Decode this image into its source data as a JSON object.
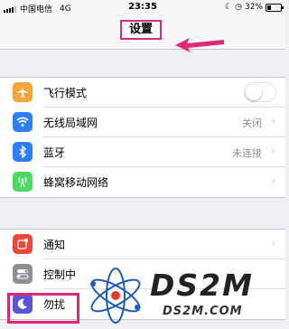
{
  "status_bar": {
    "carrier": "中国电信",
    "network": "4G",
    "time": "23:35",
    "battery": "32%",
    "battery_level": 0.32
  },
  "header": {
    "title": "设置"
  },
  "groups": [
    {
      "items": [
        {
          "label": "飞行模式",
          "icon": "airplane-icon",
          "color": "#f5a33b",
          "toggle": false
        },
        {
          "label": "无线局域网",
          "icon": "wifi-icon",
          "color": "#2c7ff7",
          "value": "关闭"
        },
        {
          "label": "蓝牙",
          "icon": "bluetooth-icon",
          "color": "#2c7ff7",
          "value": "未连接"
        },
        {
          "label": "蜂窝移动网络",
          "icon": "cellular-icon",
          "color": "#4cd964",
          "value": ""
        }
      ]
    },
    {
      "items": [
        {
          "label": "通知",
          "icon": "notifications-icon",
          "color": "#f0453a"
        },
        {
          "label": "控制中",
          "icon": "control-center-icon",
          "color": "#8e8e93"
        },
        {
          "label": "勿扰",
          "icon": "do-not-disturb-icon",
          "color": "#5856d6"
        }
      ]
    }
  ],
  "watermark": {
    "brand": "DS2M",
    "url": "DS2M.COM"
  },
  "colors": {
    "highlight": "#e0287a"
  }
}
